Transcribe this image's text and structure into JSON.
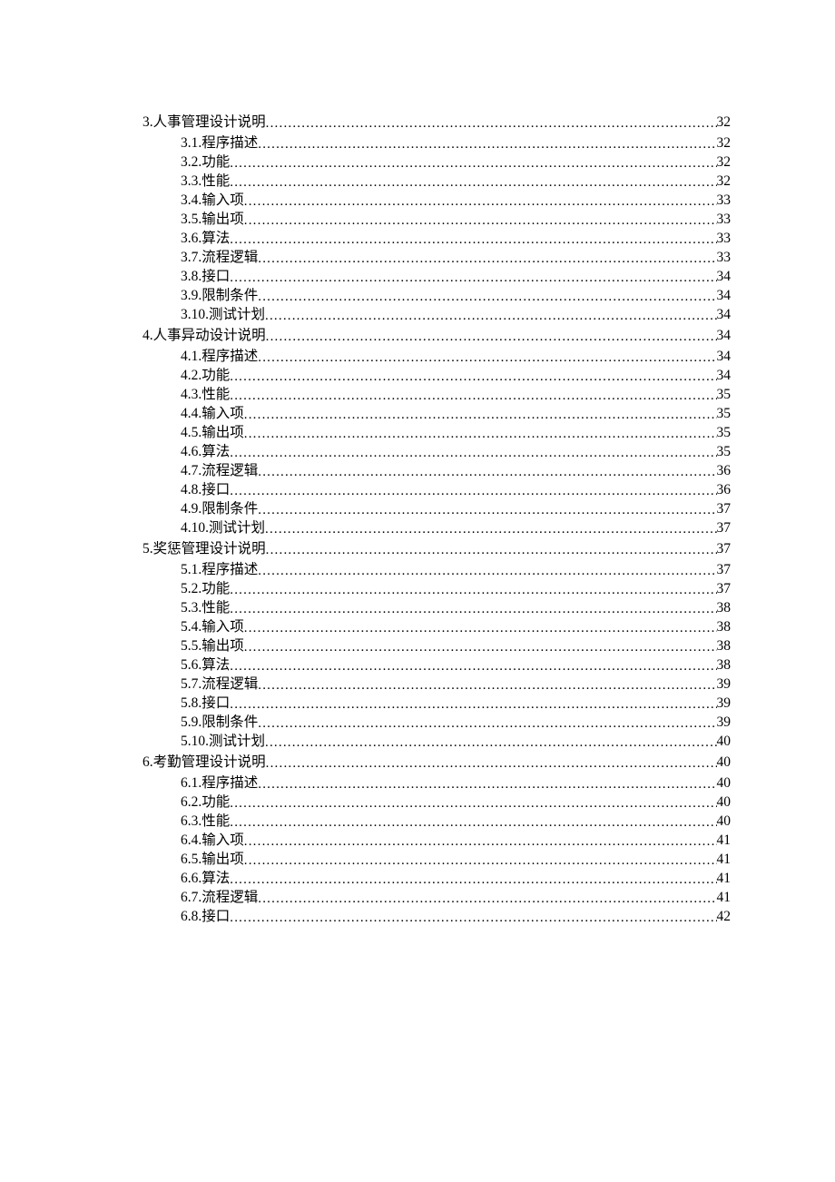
{
  "toc": [
    {
      "level": 1,
      "label": "3.人事管理设计说明",
      "page": "32"
    },
    {
      "level": 2,
      "label": "3.1.程序描述",
      "page": "32"
    },
    {
      "level": 2,
      "label": "3.2.功能",
      "page": "32"
    },
    {
      "level": 2,
      "label": "3.3.性能",
      "page": "32"
    },
    {
      "level": 2,
      "label": "3.4.输入项",
      "page": "33"
    },
    {
      "level": 2,
      "label": "3.5.输出项",
      "page": "33"
    },
    {
      "level": 2,
      "label": "3.6.算法",
      "page": "33"
    },
    {
      "level": 2,
      "label": "3.7.流程逻辑",
      "page": "33"
    },
    {
      "level": 2,
      "label": "3.8.接口",
      "page": "34"
    },
    {
      "level": 2,
      "label": "3.9.限制条件",
      "page": "34"
    },
    {
      "level": 2,
      "label": "3.10.测试计划",
      "page": "34"
    },
    {
      "level": 1,
      "label": "4.人事异动设计说明",
      "page": "34"
    },
    {
      "level": 2,
      "label": "4.1.程序描述",
      "page": "34"
    },
    {
      "level": 2,
      "label": "4.2.功能",
      "page": "34"
    },
    {
      "level": 2,
      "label": "4.3.性能",
      "page": "35"
    },
    {
      "level": 2,
      "label": "4.4.输入项",
      "page": "35"
    },
    {
      "level": 2,
      "label": "4.5.输出项",
      "page": "35"
    },
    {
      "level": 2,
      "label": "4.6.算法",
      "page": "35"
    },
    {
      "level": 2,
      "label": "4.7.流程逻辑",
      "page": "36"
    },
    {
      "level": 2,
      "label": "4.8.接口",
      "page": "36"
    },
    {
      "level": 2,
      "label": "4.9.限制条件",
      "page": "37"
    },
    {
      "level": 2,
      "label": "4.10.测试计划",
      "page": "37"
    },
    {
      "level": 1,
      "label": "5.奖惩管理设计说明",
      "page": "37"
    },
    {
      "level": 2,
      "label": "5.1.程序描述",
      "page": "37"
    },
    {
      "level": 2,
      "label": "5.2.功能",
      "page": "37"
    },
    {
      "level": 2,
      "label": "5.3.性能",
      "page": "38"
    },
    {
      "level": 2,
      "label": "5.4.输入项",
      "page": "38"
    },
    {
      "level": 2,
      "label": "5.5.输出项",
      "page": "38"
    },
    {
      "level": 2,
      "label": "5.6.算法",
      "page": "38"
    },
    {
      "level": 2,
      "label": "5.7.流程逻辑",
      "page": "39"
    },
    {
      "level": 2,
      "label": "5.8.接口",
      "page": "39"
    },
    {
      "level": 2,
      "label": "5.9.限制条件",
      "page": "39"
    },
    {
      "level": 2,
      "label": "5.10.测试计划",
      "page": "40"
    },
    {
      "level": 1,
      "label": "6.考勤管理设计说明",
      "page": "40"
    },
    {
      "level": 2,
      "label": "6.1.程序描述",
      "page": "40"
    },
    {
      "level": 2,
      "label": "6.2.功能",
      "page": "40"
    },
    {
      "level": 2,
      "label": "6.3.性能",
      "page": "40"
    },
    {
      "level": 2,
      "label": "6.4.输入项",
      "page": "41"
    },
    {
      "level": 2,
      "label": "6.5.输出项",
      "page": "41"
    },
    {
      "level": 2,
      "label": "6.6.算法",
      "page": "41"
    },
    {
      "level": 2,
      "label": "6.7.流程逻辑",
      "page": "41"
    },
    {
      "level": 2,
      "label": "6.8.接口",
      "page": "42"
    }
  ]
}
